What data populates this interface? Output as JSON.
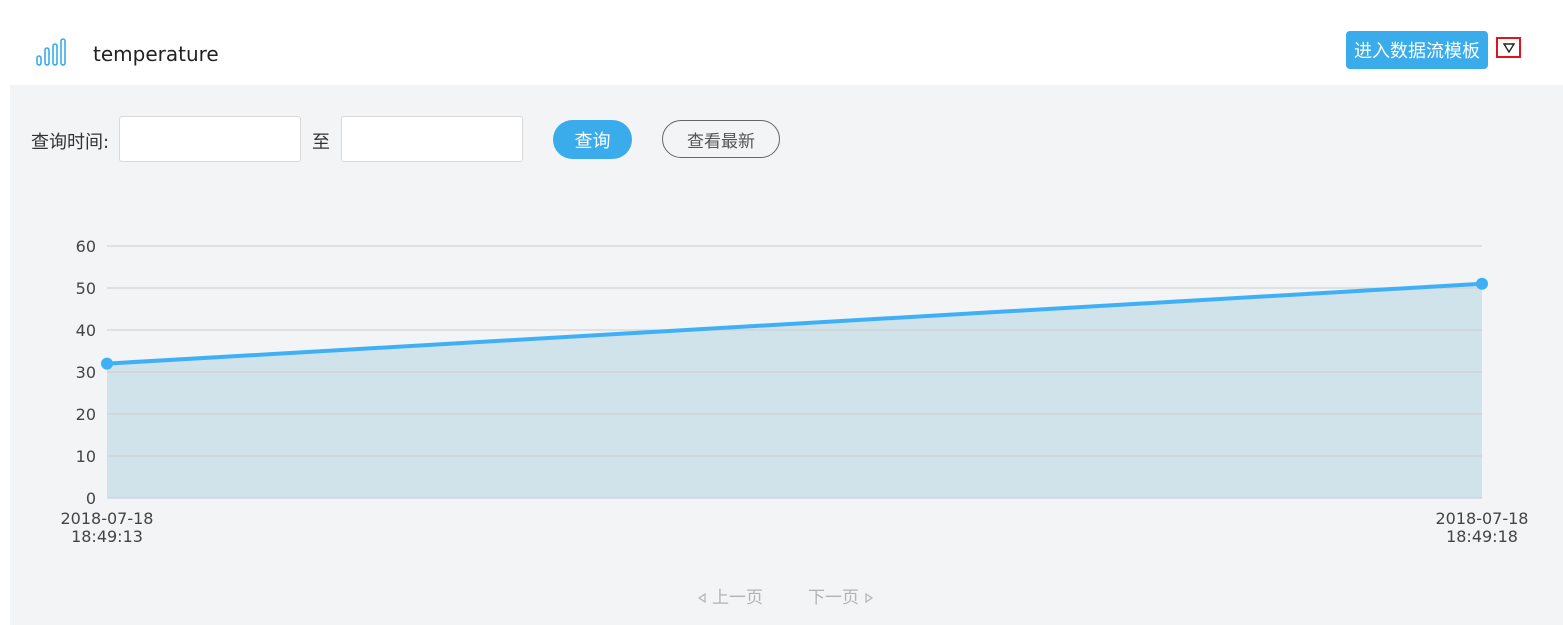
{
  "header": {
    "title": "temperature",
    "enter_template_label": "进入数据流模板"
  },
  "query": {
    "label": "查询时间:",
    "start_value": "",
    "to_label": "至",
    "end_value": "",
    "query_button": "查询",
    "latest_button": "查看最新"
  },
  "pager": {
    "prev_label": "上一页",
    "next_label": "下一页"
  },
  "colors": {
    "accent": "#3aabeb",
    "line": "#3fb0f5",
    "area": "#d0e3ea",
    "panel_bg": "#f3f4f6"
  },
  "chart_data": {
    "type": "area",
    "x": [
      "2018-07-18 18:49:13",
      "2018-07-18 18:49:18"
    ],
    "x_labels": [
      [
        "2018-07-18",
        "18:49:13"
      ],
      [
        "2018-07-18",
        "18:49:18"
      ]
    ],
    "series": [
      {
        "values": [
          32,
          51
        ]
      }
    ],
    "ylim": [
      0,
      60
    ],
    "yticks": [
      0,
      10,
      20,
      30,
      40,
      50,
      60
    ],
    "grid": true
  }
}
